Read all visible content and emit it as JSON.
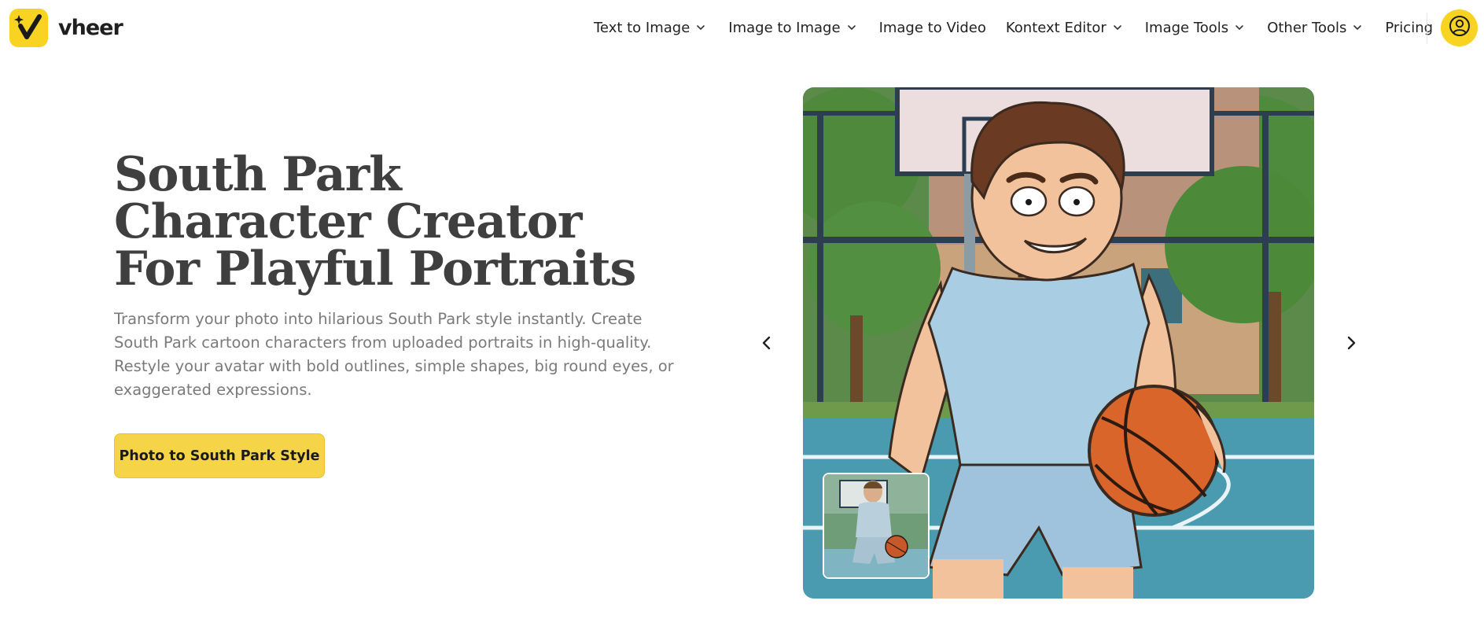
{
  "brand": {
    "name": "vheer",
    "accent": "#f9d322",
    "logo_icon": "v-check-sparkle-icon"
  },
  "nav": {
    "items": [
      {
        "label": "Text to Image",
        "dropdown": true
      },
      {
        "label": "Image to Image",
        "dropdown": true
      },
      {
        "label": "Image to Video",
        "dropdown": false
      },
      {
        "label": "Kontext Editor",
        "dropdown": true
      },
      {
        "label": "Image Tools",
        "dropdown": true
      },
      {
        "label": "Other Tools",
        "dropdown": true
      },
      {
        "label": "Pricing",
        "dropdown": false
      }
    ],
    "account_icon": "user-circle-icon"
  },
  "hero": {
    "title": "South Park Character Creator For Playful Portraits",
    "description": "Transform your photo into hilarious South Park style instantly. Create South Park cartoon characters from uploaded portraits in high-quality. Restyle your avatar with bold outlines, simple shapes, big round eyes, or exaggerated expressions.",
    "cta_label": "Photo to South Park Style",
    "cta_color": "#f5d547"
  },
  "carousel": {
    "prev_icon": "chevron-left-icon",
    "next_icon": "chevron-right-icon",
    "main_image": "cartoon basketball player illustration",
    "thumbnail_image": "original basketball player photo"
  }
}
